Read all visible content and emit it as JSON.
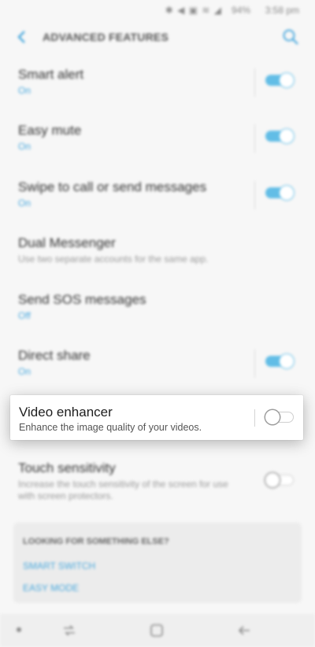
{
  "status_bar": {
    "battery": "94%",
    "time": "3:58 pm",
    "icons": [
      "bluetooth-icon",
      "mute-icon",
      "nfc-icon",
      "wifi-icon",
      "signal-icon",
      "battery-icon"
    ]
  },
  "header": {
    "title": "ADVANCED FEATURES",
    "back_icon": "back-arrow-icon",
    "search_icon": "search-icon"
  },
  "rows": [
    {
      "title": "Smart alert",
      "sub": "On",
      "toggle": true
    },
    {
      "title": "Easy mute",
      "sub": "On",
      "toggle": true
    },
    {
      "title": "Swipe to call or send messages",
      "sub": "On",
      "toggle": true
    },
    {
      "title": "Dual Messenger",
      "sub": "Use two separate accounts for the same app.",
      "toggle": null
    },
    {
      "title": "Send SOS messages",
      "sub": "Off",
      "toggle": null
    },
    {
      "title": "Direct share",
      "sub": "On",
      "toggle": true
    },
    {
      "title": "Video enhancer",
      "sub": "Enhance the image quality of your videos.",
      "toggle": false
    },
    {
      "title": "Touch sensitivity",
      "sub": "Increase the touch sensitivity of the screen for use with screen protectors.",
      "toggle": false
    }
  ],
  "suggestions": {
    "title": "LOOKING FOR SOMETHING ELSE?",
    "links": [
      "SMART SWITCH",
      "EASY MODE"
    ]
  },
  "colors": {
    "accent": "#48a8dd",
    "toggle_on": "#62bde6",
    "background": "#f7f7f7"
  }
}
